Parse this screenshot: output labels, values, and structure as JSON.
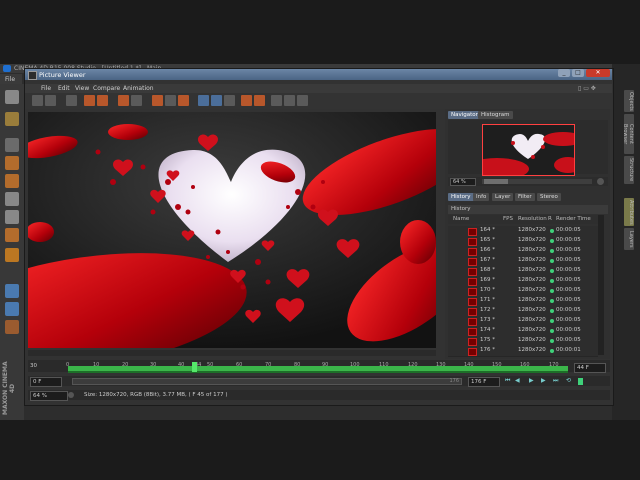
{
  "app": {
    "title": "CINEMA 4D R15.008 Studio - [Untitled 1 *] - Main",
    "menu_label": "File",
    "logo_text": "MAXON CINEMA 4D"
  },
  "picture_viewer": {
    "title": "Picture Viewer",
    "menu": [
      "File",
      "Edit",
      "View",
      "Compare",
      "Animation"
    ],
    "window_buttons": [
      "_",
      "□",
      "✕"
    ]
  },
  "navigator": {
    "tabs": [
      "Navigator",
      "Histogram"
    ],
    "zoom": "64 %"
  },
  "history": {
    "tabs": [
      "History",
      "Info",
      "Layer",
      "Filter",
      "Stereo"
    ],
    "section_title": "History",
    "columns": [
      "Name",
      "FPS",
      "Resolution",
      "R",
      "Render Time"
    ],
    "rows": [
      {
        "name": "164 *",
        "res": "1280x720",
        "time": "00:00:05"
      },
      {
        "name": "165 *",
        "res": "1280x720",
        "time": "00:00:05"
      },
      {
        "name": "166 *",
        "res": "1280x720",
        "time": "00:00:05"
      },
      {
        "name": "167 *",
        "res": "1280x720",
        "time": "00:00:05"
      },
      {
        "name": "168 *",
        "res": "1280x720",
        "time": "00:00:05"
      },
      {
        "name": "169 *",
        "res": "1280x720",
        "time": "00:00:05"
      },
      {
        "name": "170 *",
        "res": "1280x720",
        "time": "00:00:05"
      },
      {
        "name": "171 *",
        "res": "1280x720",
        "time": "00:00:05"
      },
      {
        "name": "172 *",
        "res": "1280x720",
        "time": "00:00:05"
      },
      {
        "name": "173 *",
        "res": "1280x720",
        "time": "00:00:05"
      },
      {
        "name": "174 *",
        "res": "1280x720",
        "time": "00:00:05"
      },
      {
        "name": "175 *",
        "res": "1280x720",
        "time": "00:00:05"
      },
      {
        "name": "176 *",
        "res": "1280x720",
        "time": "00:00:01"
      }
    ]
  },
  "timeline": {
    "ticks": [
      "0",
      "10",
      "20",
      "30",
      "40",
      "44",
      "50",
      "60",
      "70",
      "80",
      "90",
      "100",
      "110",
      "120",
      "130",
      "140",
      "150",
      "160",
      "170"
    ],
    "fps": "30",
    "start": "0 F",
    "end": "176 F",
    "current": "44 F",
    "slider_end": "176",
    "current_frame": 44
  },
  "status": {
    "zoom": "64 %",
    "text": "Size: 1280x720, RGB (8Bit), 3.77 MB,  ( F 45 of 177 )"
  },
  "right_tabs": [
    "Objects",
    "Content Browser",
    "Structure",
    "Attributes",
    "Layers"
  ],
  "colors": {
    "accent": "#5a6c85",
    "timeline": "#3bb54a",
    "heart": "#c8101a"
  }
}
